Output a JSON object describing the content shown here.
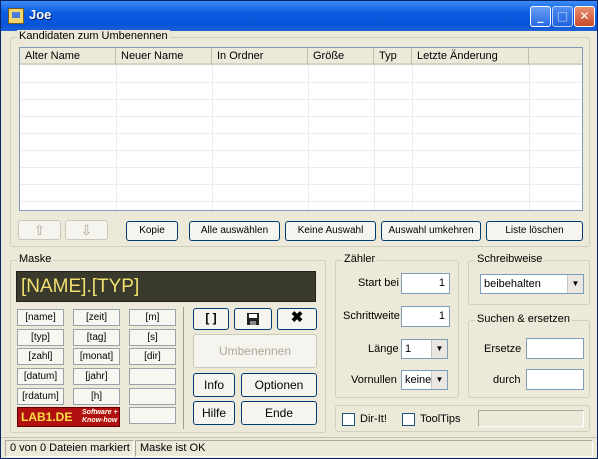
{
  "window": {
    "title": "Joe"
  },
  "titlebar_buttons": {
    "minimize": "_",
    "maximize": "□",
    "close": "✕"
  },
  "candidates": {
    "legend": "Kandidaten zum Umbenennen",
    "columns": [
      "Alter Name",
      "Neuer Name",
      "In Ordner",
      "Größe",
      "Typ",
      "Letzte Änderung"
    ],
    "buttons": {
      "up": "⇧",
      "down": "⇩",
      "copy": "Kopie",
      "select_all": "Alle auswählen",
      "select_none": "Keine Auswahl",
      "invert": "Auswahl umkehren",
      "clear": "Liste löschen"
    }
  },
  "mask": {
    "legend": "Maske",
    "value": "[NAME].[TYP]",
    "tokens": [
      "[name]",
      "[zeit]",
      "[m]",
      "[typ]",
      "[tag]",
      "[s]",
      "[zahl]",
      "[monat]",
      "[dir]",
      "[datum]",
      "[jahr]",
      "",
      "[rdatum]",
      "[h]",
      ""
    ],
    "brackets_button": "[ ]",
    "save_icon": "floppy-disk",
    "delete_icon": "✖",
    "rename": "Umbenennen",
    "info": "Info",
    "options": "Optionen",
    "help": "Hilfe",
    "end": "Ende",
    "logo_text": "LAB1.DE",
    "logo_sub": "Software + Know-how"
  },
  "counter": {
    "legend": "Zähler",
    "start_label": "Start bei",
    "start_value": "1",
    "step_label": "Schrittweite",
    "step_value": "1",
    "length_label": "Länge",
    "length_value": "1",
    "pad_label": "Vornullen",
    "pad_value": "keine"
  },
  "case": {
    "legend": "Schreibweise",
    "value": "beibehalten"
  },
  "replace": {
    "legend": "Suchen & ersetzen",
    "replace_label": "Ersetze",
    "with_label": "durch"
  },
  "options": {
    "dirit": "Dir-It!",
    "tooltips": "ToolTips"
  },
  "statusbar": {
    "marked": "0 von 0 Dateien markiert",
    "mask_status": "Maske ist OK"
  }
}
